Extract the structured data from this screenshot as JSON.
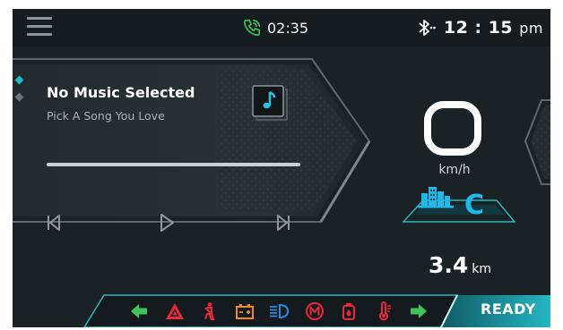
{
  "topbar": {
    "menu_icon": "hamburger-menu-icon",
    "call_icon": "phone-call-icon",
    "call_time": "02:35",
    "bluetooth_icon": "bluetooth-icon",
    "clock": "12 : 15",
    "ampm": "pm"
  },
  "media": {
    "title": "No Music Selected",
    "subtitle": "Pick A Song You Love",
    "note_icon": "music-note-icon",
    "progress": 0,
    "controls": [
      "skip-previous-icon",
      "play-icon",
      "skip-next-icon"
    ]
  },
  "cluster": {
    "speed": "0",
    "speed_unit": "km/h",
    "drive_mode_icon": "city-buildings-icon",
    "drive_mode_letter": "C",
    "odometer_value": "3.4",
    "odometer_unit": "km"
  },
  "telltales": [
    "left-turn-arrow-icon",
    "hazard-warning-icon",
    "seatbelt-icon",
    "battery-icon",
    "headlight-icon",
    "engine-check-icon",
    "oil-icon",
    "temperature-icon",
    "right-turn-arrow-icon"
  ],
  "status": {
    "ready_label": "READY"
  },
  "colors": {
    "background": "#1b2226",
    "accent_teal": "#25b7c3",
    "accent_blue": "#1fb8e8",
    "call_green": "#3ec45a",
    "warning_red": "#e8293a",
    "warning_orange": "#f08a1f"
  }
}
